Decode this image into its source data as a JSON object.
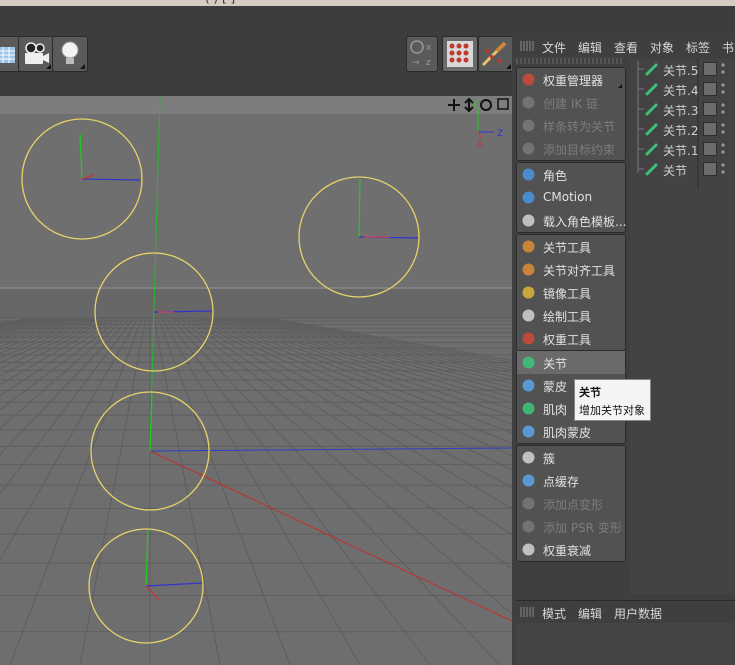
{
  "window": {
    "title_fragment": "(          )  [          ]"
  },
  "viewport": {
    "axis_labels": {
      "y": "Y",
      "z": "Z",
      "x": "X"
    }
  },
  "object_manager": {
    "menu": [
      "文件",
      "编辑",
      "查看",
      "对象",
      "标签",
      "书"
    ],
    "objects": [
      "关节.5",
      "关节.4",
      "关节.3",
      "关节.2",
      "关节.1",
      "关节"
    ]
  },
  "tools": {
    "group1": [
      {
        "label": "权重管理器",
        "disabled": false,
        "icon": "weight-manager-icon"
      },
      {
        "label": "创建 IK 链",
        "disabled": true,
        "icon": "ik-chain-icon"
      },
      {
        "label": "样条转为关节",
        "disabled": true,
        "icon": "spline-to-joint-icon"
      },
      {
        "label": "添加目标约束",
        "disabled": true,
        "icon": "target-constraint-icon"
      }
    ],
    "group2": [
      {
        "label": "角色",
        "icon": "character-icon"
      },
      {
        "label": "CMotion",
        "icon": "cmotion-icon"
      },
      {
        "label": "载入角色模板...",
        "icon": "character-template-icon"
      }
    ],
    "group3": [
      {
        "label": "关节工具",
        "icon": "joint-tool-icon"
      },
      {
        "label": "关节对齐工具",
        "icon": "joint-align-icon"
      },
      {
        "label": "镜像工具",
        "icon": "mirror-tool-icon"
      },
      {
        "label": "绘制工具",
        "icon": "paint-tool-icon"
      },
      {
        "label": "权重工具",
        "icon": "weight-tool-icon"
      }
    ],
    "group4": [
      {
        "label": "关节",
        "icon": "joint-icon",
        "highlighted": true
      },
      {
        "label": "蒙皮",
        "icon": "skin-icon"
      },
      {
        "label": "肌肉",
        "icon": "muscle-icon"
      },
      {
        "label": "肌肉蒙皮",
        "icon": "muscle-skin-icon"
      }
    ],
    "group5": [
      {
        "label": "簇",
        "icon": "cluster-icon"
      },
      {
        "label": "点缓存",
        "icon": "point-cache-icon"
      },
      {
        "label": "添加点变形",
        "disabled": true,
        "icon": "pose-morph-icon"
      },
      {
        "label": "添加 PSR 变形",
        "disabled": true,
        "icon": "psr-morph-icon"
      },
      {
        "label": "权重衰减",
        "icon": "weight-falloff-icon"
      }
    ]
  },
  "tooltip": {
    "title": "关节",
    "description": "增加关节对象"
  },
  "attributes": {
    "menu": [
      "模式",
      "编辑",
      "用户数据"
    ]
  },
  "colors": {
    "viewport_bg": "#6e6e6e",
    "circle": "#e6d36a",
    "axis_x": "#d33",
    "axis_y": "#2c2",
    "axis_z": "#33c",
    "joint_green": "#3ec07a"
  }
}
